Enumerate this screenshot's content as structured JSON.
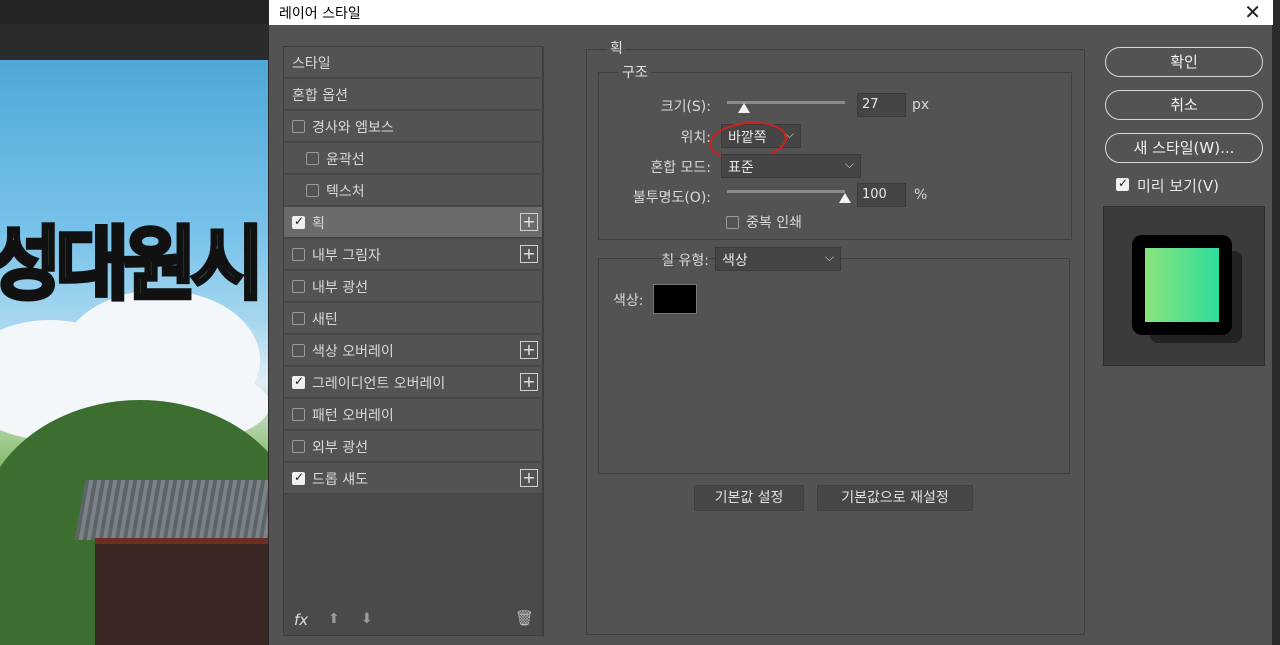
{
  "dialog": {
    "title": "레이어 스타일",
    "close_glyph": "✕"
  },
  "styles": [
    {
      "label": "스타일",
      "checkbox": false,
      "checked": false,
      "plus": false,
      "indent": false,
      "active": false
    },
    {
      "label": "혼합 옵션",
      "checkbox": false,
      "checked": false,
      "plus": false,
      "indent": false,
      "active": false
    },
    {
      "label": "경사와 엠보스",
      "checkbox": true,
      "checked": false,
      "plus": false,
      "indent": false,
      "active": false
    },
    {
      "label": "윤곽선",
      "checkbox": true,
      "checked": false,
      "plus": false,
      "indent": true,
      "active": false
    },
    {
      "label": "텍스처",
      "checkbox": true,
      "checked": false,
      "plus": false,
      "indent": true,
      "active": false
    },
    {
      "label": "획",
      "checkbox": true,
      "checked": true,
      "plus": true,
      "indent": false,
      "active": true
    },
    {
      "label": "내부 그림자",
      "checkbox": true,
      "checked": false,
      "plus": true,
      "indent": false,
      "active": false
    },
    {
      "label": "내부 광선",
      "checkbox": true,
      "checked": false,
      "plus": false,
      "indent": false,
      "active": false
    },
    {
      "label": "새틴",
      "checkbox": true,
      "checked": false,
      "plus": false,
      "indent": false,
      "active": false
    },
    {
      "label": "색상 오버레이",
      "checkbox": true,
      "checked": false,
      "plus": true,
      "indent": false,
      "active": false
    },
    {
      "label": "그레이디언트 오버레이",
      "checkbox": true,
      "checked": true,
      "plus": true,
      "indent": false,
      "active": false
    },
    {
      "label": "패턴 오버레이",
      "checkbox": true,
      "checked": false,
      "plus": false,
      "indent": false,
      "active": false
    },
    {
      "label": "외부 광선",
      "checkbox": true,
      "checked": false,
      "plus": false,
      "indent": false,
      "active": false
    },
    {
      "label": "드롭 섀도",
      "checkbox": true,
      "checked": true,
      "plus": true,
      "indent": false,
      "active": false
    }
  ],
  "list_footer": {
    "fx": "fx",
    "up_arrow": "⬆",
    "down_arrow": "⬇",
    "trash": "🗑"
  },
  "stroke": {
    "section_title": "획",
    "structure_title": "구조",
    "size_label": "크기(S):",
    "size_value": "27",
    "size_unit": "px",
    "position_label": "위치:",
    "position_value": "바깥쪽",
    "blend_label": "혼합 모드:",
    "blend_value": "표준",
    "opacity_label": "불투명도(O):",
    "opacity_value": "100",
    "opacity_unit": "%",
    "overprint_label": "중복 인쇄",
    "overprint_checked": false,
    "fill_type_label": "칠 유형:",
    "fill_type_value": "색상",
    "color_label": "색상:",
    "color_value": "#000000",
    "size_slider_fraction": 0.14,
    "opacity_slider_fraction": 1.0
  },
  "bottom_buttons": {
    "make_default": "기본값 설정",
    "reset_default": "기본값으로 재설정"
  },
  "right_panel": {
    "ok": "확인",
    "cancel": "취소",
    "new_style": "새 스타일(W)...",
    "preview_label": "미리 보기(V)",
    "preview_checked": true
  },
  "canvas": {
    "overlay_text": "성대원시"
  },
  "colors": {
    "dialog_bg": "#535353",
    "annotation": "#d0221c",
    "preview_gradient_start": "#8be47c",
    "preview_gradient_end": "#2ddc9a"
  },
  "icons": {
    "chevron": "⌵",
    "plus": "+"
  }
}
